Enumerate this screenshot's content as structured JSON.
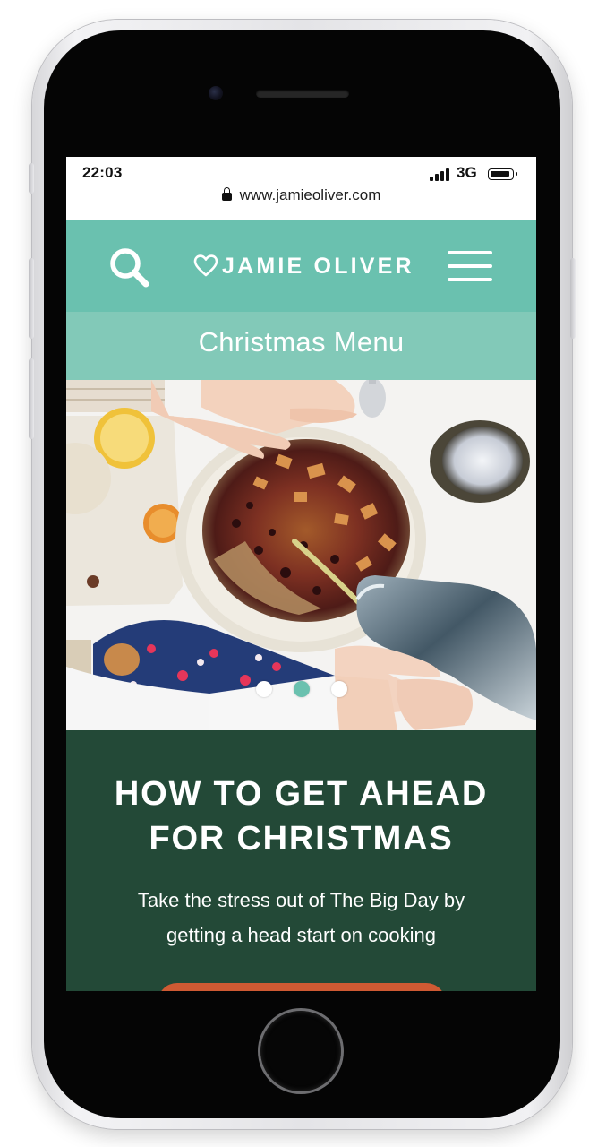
{
  "status_bar": {
    "time": "22:03",
    "network": "3G"
  },
  "browser": {
    "url": "www.jamieoliver.com"
  },
  "header": {
    "logo_text": "JAMIE OLIVER",
    "background_color": "#6ac1af",
    "search_icon": "search-icon",
    "menu_icon": "hamburger-menu-icon",
    "logo_icon": "heart-icon"
  },
  "section": {
    "title": "Christmas Menu",
    "background_color": "#82c9b8"
  },
  "hero": {
    "image": "mixing-bowl-christmas-pudding-photo",
    "carousel": {
      "count": 3,
      "active_index": 1
    }
  },
  "feature": {
    "title": "HOW TO GET AHEAD FOR CHRISTMAS",
    "description": "Take the stress out of The Big Day by getting a head start on cooking",
    "background_color": "#234937",
    "button_color": "#cf5a33"
  }
}
